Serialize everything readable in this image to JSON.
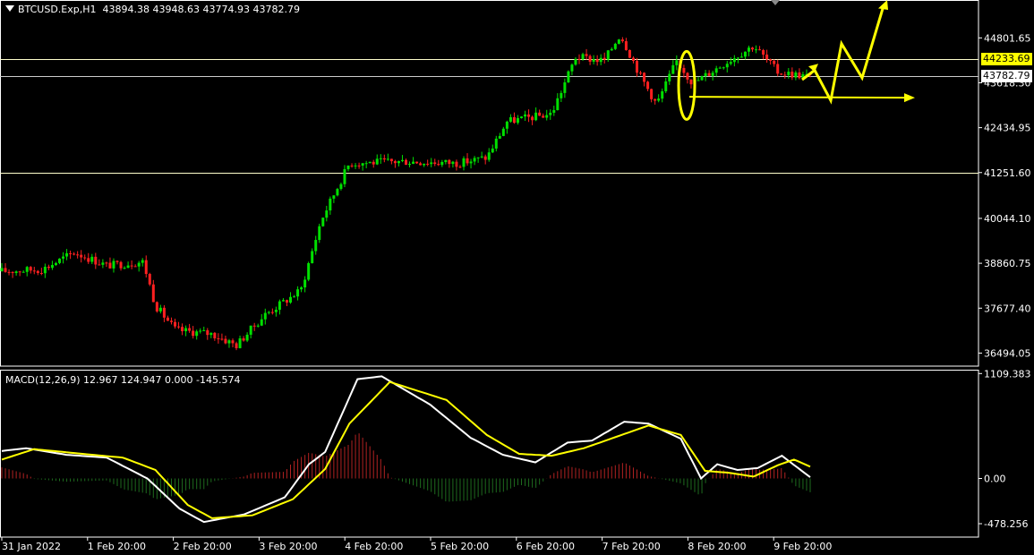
{
  "header": {
    "symbol": "BTCUSD.Exp,H1",
    "open": "43894.38",
    "high": "43948.63",
    "low": "43774.93",
    "close": "43782.79"
  },
  "macd_header": "MACD(12,26,9) 12.967 124.947 0.000 -145.574",
  "price_tags": {
    "level": "44233.69",
    "current": "43782.79"
  },
  "colors": {
    "background": "#000000",
    "bull_candle": "#00e000",
    "bear_candle": "#ff2020",
    "annotation": "#ffff00",
    "level_line": "#ffffcc",
    "macd_line": "#ffffff",
    "signal_line": "#ffff00",
    "hist_pos": "#b22222",
    "hist_neg": "#1e6b1e"
  },
  "chart_data": [
    {
      "type": "candlestick",
      "title": "BTCUSD.Exp,H1",
      "x_labels": [
        "31 Jan 2022",
        "1 Feb 20:00",
        "2 Feb 20:00",
        "3 Feb 20:00",
        "4 Feb 20:00",
        "5 Feb 20:00",
        "6 Feb 20:00",
        "7 Feb 20:00",
        "8 Feb 20:00",
        "9 Feb 20:00"
      ],
      "y_ticks": [
        "44801.65",
        "43618.30",
        "42434.95",
        "41251.60",
        "40044.10",
        "38860.75",
        "37677.40",
        "36494.05"
      ],
      "ylim": [
        36150,
        45800
      ],
      "horizontal_levels": [
        44233.69,
        43782.79,
        41251.6
      ],
      "close_path": [
        {
          "t": 0,
          "v": 38650
        },
        {
          "t": 0.05,
          "v": 38700
        },
        {
          "t": 0.09,
          "v": 39150
        },
        {
          "t": 0.13,
          "v": 38800
        },
        {
          "t": 0.175,
          "v": 38900
        },
        {
          "t": 0.19,
          "v": 37750
        },
        {
          "t": 0.215,
          "v": 37100
        },
        {
          "t": 0.26,
          "v": 37000
        },
        {
          "t": 0.29,
          "v": 36700
        },
        {
          "t": 0.325,
          "v": 37500
        },
        {
          "t": 0.37,
          "v": 38150
        },
        {
          "t": 0.395,
          "v": 40000
        },
        {
          "t": 0.43,
          "v": 41500
        },
        {
          "t": 0.5,
          "v": 41550
        },
        {
          "t": 0.565,
          "v": 41500
        },
        {
          "t": 0.6,
          "v": 41650
        },
        {
          "t": 0.625,
          "v": 42600
        },
        {
          "t": 0.68,
          "v": 42800
        },
        {
          "t": 0.71,
          "v": 44300
        },
        {
          "t": 0.745,
          "v": 44200
        },
        {
          "t": 0.765,
          "v": 44900
        },
        {
          "t": 0.79,
          "v": 43800
        },
        {
          "t": 0.81,
          "v": 43050
        },
        {
          "t": 0.835,
          "v": 44200
        },
        {
          "t": 0.855,
          "v": 43600
        },
        {
          "t": 0.895,
          "v": 44150
        },
        {
          "t": 0.93,
          "v": 44600
        },
        {
          "t": 0.96,
          "v": 43900
        },
        {
          "t": 1.0,
          "v": 43782.79
        }
      ]
    },
    {
      "type": "line",
      "title": "MACD(12,26,9)",
      "values_text": "12.967 124.947 0.000 -145.574",
      "y_ticks": [
        "1109.383",
        "0.00",
        "-478.256"
      ],
      "ylim": [
        -620,
        1150
      ],
      "series": [
        {
          "name": "MACD",
          "points": [
            {
              "t": 0,
              "v": 290
            },
            {
              "t": 0.03,
              "v": 320
            },
            {
              "t": 0.08,
              "v": 250
            },
            {
              "t": 0.13,
              "v": 220
            },
            {
              "t": 0.18,
              "v": 0
            },
            {
              "t": 0.22,
              "v": -320
            },
            {
              "t": 0.25,
              "v": -460
            },
            {
              "t": 0.3,
              "v": -380
            },
            {
              "t": 0.35,
              "v": -200
            },
            {
              "t": 0.38,
              "v": 150
            },
            {
              "t": 0.4,
              "v": 280
            },
            {
              "t": 0.44,
              "v": 1050
            },
            {
              "t": 0.47,
              "v": 1080
            },
            {
              "t": 0.53,
              "v": 780
            },
            {
              "t": 0.58,
              "v": 430
            },
            {
              "t": 0.62,
              "v": 250
            },
            {
              "t": 0.66,
              "v": 170
            },
            {
              "t": 0.7,
              "v": 380
            },
            {
              "t": 0.73,
              "v": 400
            },
            {
              "t": 0.77,
              "v": 600
            },
            {
              "t": 0.8,
              "v": 580
            },
            {
              "t": 0.84,
              "v": 420
            },
            {
              "t": 0.865,
              "v": 0
            },
            {
              "t": 0.885,
              "v": 150
            },
            {
              "t": 0.91,
              "v": 90
            },
            {
              "t": 0.935,
              "v": 110
            },
            {
              "t": 0.965,
              "v": 240
            },
            {
              "t": 1.0,
              "v": 12.967
            }
          ]
        },
        {
          "name": "Signal",
          "points": [
            {
              "t": 0,
              "v": 200
            },
            {
              "t": 0.04,
              "v": 310
            },
            {
              "t": 0.1,
              "v": 260
            },
            {
              "t": 0.15,
              "v": 220
            },
            {
              "t": 0.19,
              "v": 90
            },
            {
              "t": 0.23,
              "v": -280
            },
            {
              "t": 0.26,
              "v": -420
            },
            {
              "t": 0.31,
              "v": -390
            },
            {
              "t": 0.36,
              "v": -220
            },
            {
              "t": 0.4,
              "v": 100
            },
            {
              "t": 0.43,
              "v": 580
            },
            {
              "t": 0.48,
              "v": 1020
            },
            {
              "t": 0.55,
              "v": 830
            },
            {
              "t": 0.6,
              "v": 460
            },
            {
              "t": 0.64,
              "v": 260
            },
            {
              "t": 0.68,
              "v": 240
            },
            {
              "t": 0.72,
              "v": 320
            },
            {
              "t": 0.76,
              "v": 440
            },
            {
              "t": 0.8,
              "v": 560
            },
            {
              "t": 0.84,
              "v": 460
            },
            {
              "t": 0.87,
              "v": 80
            },
            {
              "t": 0.9,
              "v": 60
            },
            {
              "t": 0.93,
              "v": 20
            },
            {
              "t": 0.96,
              "v": 140
            },
            {
              "t": 0.98,
              "v": 200
            },
            {
              "t": 1.0,
              "v": 124.947
            }
          ]
        }
      ]
    }
  ]
}
